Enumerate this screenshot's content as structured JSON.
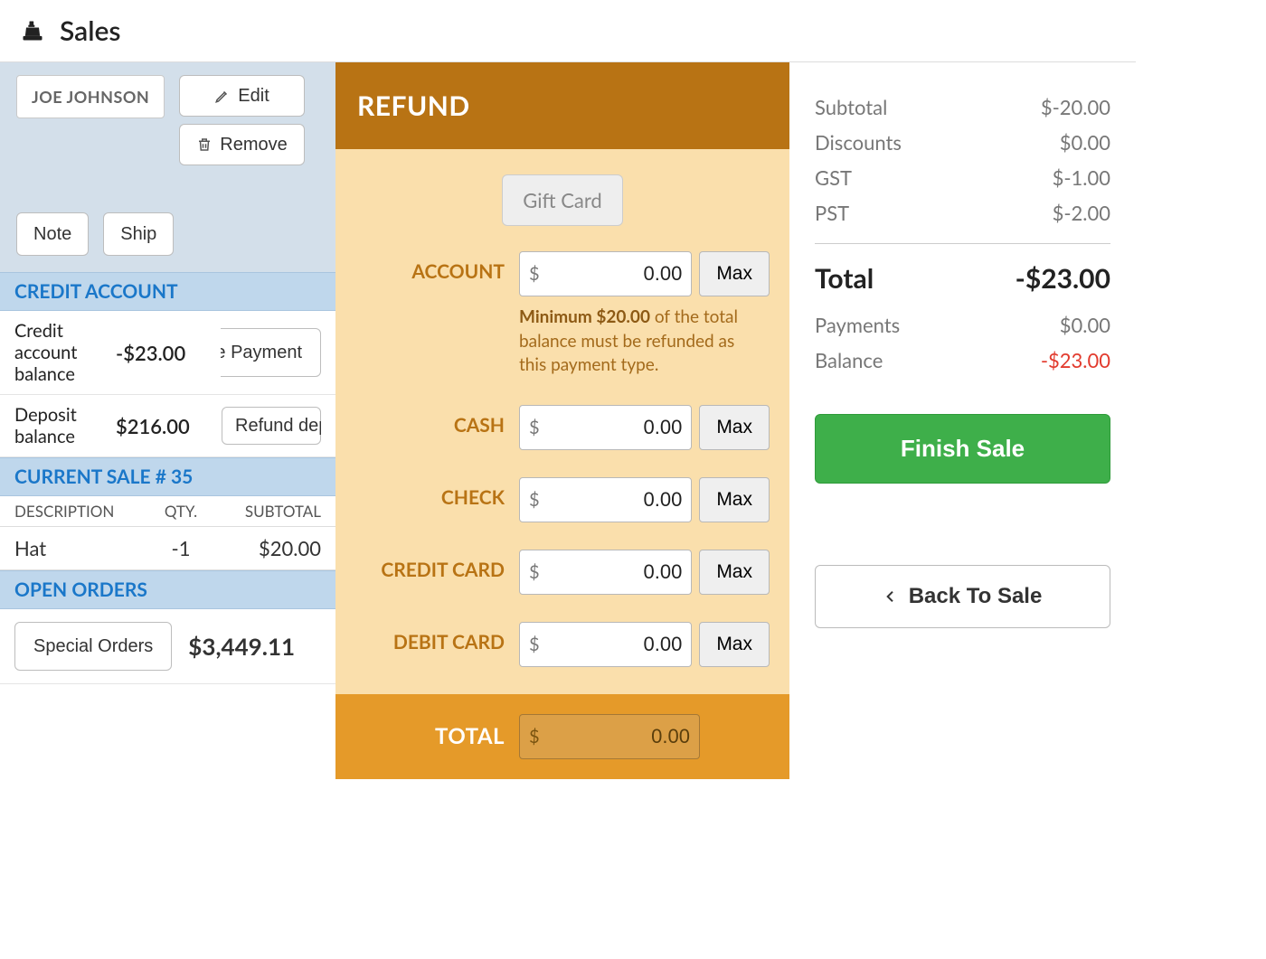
{
  "header": {
    "title": "Sales"
  },
  "customer": {
    "name": "JOE JOHNSON",
    "edit_label": "Edit",
    "remove_label": "Remove",
    "note_label": "Note",
    "ship_label": "Ship"
  },
  "credit_account": {
    "header": "CREDIT ACCOUNT",
    "balance_label": "Credit account balance",
    "balance_value": "-$23.00",
    "make_payment_label": "Make Payment",
    "deposit_label": "Deposit balance",
    "deposit_value": "$216.00",
    "refund_deposit_label": "Refund deposit"
  },
  "current_sale": {
    "header": "CURRENT SALE # 35",
    "cols": {
      "desc": "DESCRIPTION",
      "qty": "QTY.",
      "sub": "SUBTOTAL"
    },
    "items": [
      {
        "desc": "Hat",
        "qty": "-1",
        "sub": "$20.00"
      }
    ]
  },
  "open_orders": {
    "header": "OPEN ORDERS",
    "button_label": "Special Orders",
    "total": "$3,449.11"
  },
  "refund": {
    "header": "REFUND",
    "gift_card_label": "Gift Card",
    "max_label": "Max",
    "currency": "$",
    "account": {
      "label": "ACCOUNT",
      "value": "0.00",
      "note_prefix": "Minimum $20.00",
      "note_rest": " of the total balance must be refunded as this payment type."
    },
    "rows": [
      {
        "label": "CASH",
        "value": "0.00"
      },
      {
        "label": "CHECK",
        "value": "0.00"
      },
      {
        "label": "CREDIT CARD",
        "value": "0.00"
      },
      {
        "label": "DEBIT CARD",
        "value": "0.00"
      }
    ],
    "total_label": "TOTAL",
    "total_value": "0.00"
  },
  "summary": {
    "subtotal_label": "Subtotal",
    "subtotal_value": "$-20.00",
    "discounts_label": "Discounts",
    "discounts_value": "$0.00",
    "gst_label": "GST",
    "gst_value": "$-1.00",
    "pst_label": "PST",
    "pst_value": "$-2.00",
    "total_label": "Total",
    "total_value": "-$23.00",
    "payments_label": "Payments",
    "payments_value": "$0.00",
    "balance_label": "Balance",
    "balance_value": "-$23.00",
    "finish_label": "Finish Sale",
    "back_label": "Back To Sale"
  }
}
